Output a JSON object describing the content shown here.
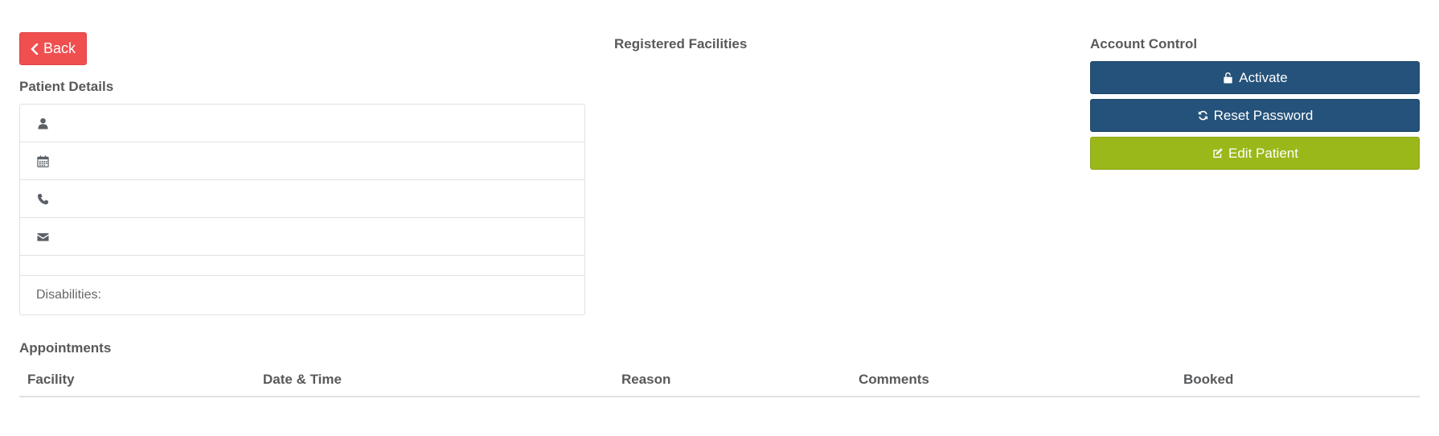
{
  "toolbar": {
    "back_label": "Back"
  },
  "patient_details": {
    "heading": "Patient Details",
    "rows": [
      {
        "icon": "user-icon",
        "value": ""
      },
      {
        "icon": "calendar-icon",
        "value": ""
      },
      {
        "icon": "phone-icon",
        "value": ""
      },
      {
        "icon": "envelope-icon",
        "value": ""
      }
    ],
    "disabilities_label": "Disabilities:"
  },
  "registered_facilities": {
    "heading": "Registered Facilities"
  },
  "account_control": {
    "heading": "Account Control",
    "activate_label": "Activate",
    "reset_password_label": "Reset Password",
    "edit_patient_label": "Edit Patient"
  },
  "appointments": {
    "heading": "Appointments",
    "columns": [
      "Facility",
      "Date & Time",
      "Reason",
      "Comments",
      "Booked"
    ],
    "rows": []
  },
  "colors": {
    "back_button": "#ef4f4f",
    "primary_button": "#24527a",
    "success_button": "#9ab819",
    "heading_text": "#58595b",
    "border": "#dfe1e3"
  }
}
